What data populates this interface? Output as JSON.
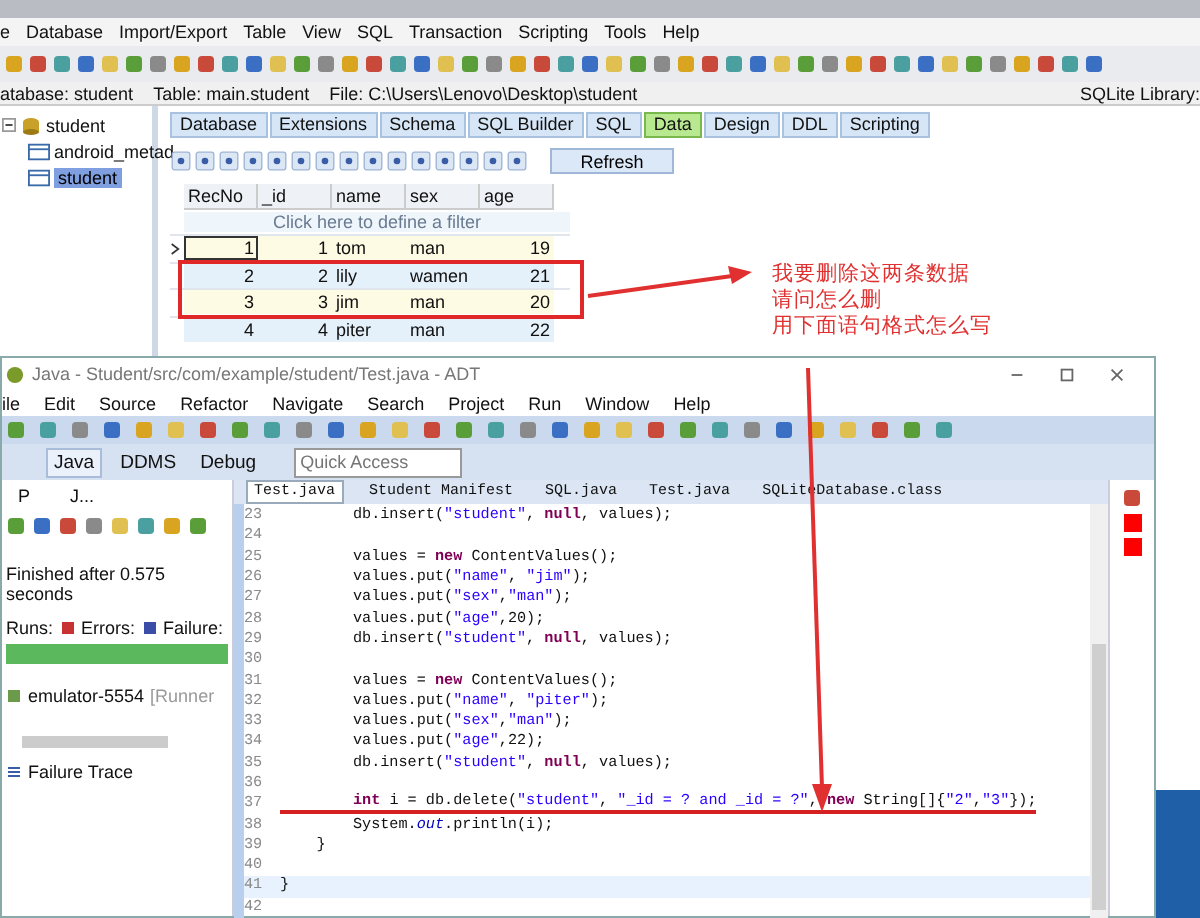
{
  "sqlite": {
    "menu": [
      "e",
      "Database",
      "Import/Export",
      "Table",
      "View",
      "SQL",
      "Transaction",
      "Scripting",
      "Tools",
      "Help"
    ],
    "info": {
      "database": "atabase: student",
      "table": "Table: main.student",
      "file": "File: C:\\Users\\Lenovo\\Desktop\\student",
      "library": "SQLite Library:"
    },
    "tree": [
      {
        "label": "student",
        "expanded": true,
        "children": [
          {
            "label": "android_metad",
            "selected": false
          },
          {
            "label": "student",
            "selected": true
          }
        ]
      }
    ],
    "tabs": [
      {
        "label": "Database",
        "selected": false
      },
      {
        "label": "Extensions",
        "selected": false
      },
      {
        "label": "Schema",
        "selected": false
      },
      {
        "label": "SQL Builder",
        "selected": false
      },
      {
        "label": "SQL",
        "selected": false
      },
      {
        "label": "Data",
        "selected": true
      },
      {
        "label": "Design",
        "selected": false
      },
      {
        "label": "DDL",
        "selected": false
      },
      {
        "label": "Scripting",
        "selected": false
      }
    ],
    "refresh": "Refresh",
    "grid": {
      "columns": [
        "RecNo",
        "_id",
        "name",
        "sex",
        "age"
      ],
      "filter": "Click here to define a filter",
      "rows": [
        {
          "cells": [
            "1",
            "1",
            "tom",
            "man",
            "19"
          ],
          "current": true
        },
        {
          "cells": [
            "2",
            "2",
            "lily",
            "wamen",
            "21"
          ],
          "current": false
        },
        {
          "cells": [
            "3",
            "3",
            "jim",
            "man",
            "20"
          ],
          "current": false
        },
        {
          "cells": [
            "4",
            "4",
            "piter",
            "man",
            "22"
          ],
          "current": false
        }
      ]
    }
  },
  "annotation": {
    "lines": [
      "我要删除这两条数据",
      "请问怎么删",
      "用下面语句格式怎么写"
    ]
  },
  "eclipse": {
    "title": "Java - Student/src/com/example/student/Test.java - ADT",
    "menu": [
      "ile",
      "Edit",
      "Source",
      "Refactor",
      "Navigate",
      "Search",
      "Project",
      "Run",
      "Window",
      "Help"
    ],
    "perspectives": [
      {
        "label": "Java",
        "selected": true
      },
      {
        "label": "DDMS",
        "selected": false
      },
      {
        "label": "Debug",
        "selected": false
      }
    ],
    "quick_access": {
      "placeholder": "Quick Access"
    },
    "panel_tabs": [
      "P",
      "J..."
    ],
    "junit": {
      "status": "Finished after 0.575 seconds",
      "runs": "Runs:",
      "errors": "Errors:",
      "failures": "Failure:",
      "level": 1,
      "runner": "emulator-5554",
      "runner_note": "[Runner",
      "trace": "Failure Trace"
    },
    "editor_tabs": [
      {
        "label": "Test.java",
        "selected": true
      },
      {
        "label": "Student Manifest",
        "selected": false
      },
      {
        "label": "SQL.java",
        "selected": false
      },
      {
        "label": "Test.java",
        "selected": false
      },
      {
        "label": "SQLiteDatabase.class",
        "selected": false
      }
    ],
    "code": [
      {
        "num": "23",
        "parts": [
          {
            "kind": "plain",
            "text": "        db.insert("
          },
          {
            "kind": "string",
            "text": "\"student\""
          },
          {
            "kind": "plain",
            "text": ", "
          },
          {
            "kind": "keyword",
            "text": "null"
          },
          {
            "kind": "plain",
            "text": ", values);"
          }
        ]
      },
      {
        "num": "24"
      },
      {
        "num": "25",
        "parts": [
          {
            "kind": "plain",
            "text": "        values = "
          },
          {
            "kind": "keyword",
            "text": "new"
          },
          {
            "kind": "plain",
            "text": " ContentValues();"
          }
        ]
      },
      {
        "num": "26",
        "parts": [
          {
            "kind": "plain",
            "text": "        values.put("
          },
          {
            "kind": "string",
            "text": "\"name\""
          },
          {
            "kind": "plain",
            "text": ", "
          },
          {
            "kind": "string",
            "text": "\"jim\""
          },
          {
            "kind": "plain",
            "text": ");"
          }
        ]
      },
      {
        "num": "27",
        "parts": [
          {
            "kind": "plain",
            "text": "        values.put("
          },
          {
            "kind": "string",
            "text": "\"sex\""
          },
          {
            "kind": "plain",
            "text": ","
          },
          {
            "kind": "string",
            "text": "\"man\""
          },
          {
            "kind": "plain",
            "text": ");"
          }
        ]
      },
      {
        "num": "28",
        "parts": [
          {
            "kind": "plain",
            "text": "        values.put("
          },
          {
            "kind": "string",
            "text": "\"age\""
          },
          {
            "kind": "plain",
            "text": ",20);"
          }
        ]
      },
      {
        "num": "29",
        "parts": [
          {
            "kind": "plain",
            "text": "        db.insert("
          },
          {
            "kind": "string",
            "text": "\"student\""
          },
          {
            "kind": "plain",
            "text": ", "
          },
          {
            "kind": "keyword",
            "text": "null"
          },
          {
            "kind": "plain",
            "text": ", values);"
          }
        ]
      },
      {
        "num": "30"
      },
      {
        "num": "31",
        "parts": [
          {
            "kind": "plain",
            "text": "        values = "
          },
          {
            "kind": "keyword",
            "text": "new"
          },
          {
            "kind": "plain",
            "text": " ContentValues();"
          }
        ]
      },
      {
        "num": "32",
        "parts": [
          {
            "kind": "plain",
            "text": "        values.put("
          },
          {
            "kind": "string",
            "text": "\"name\""
          },
          {
            "kind": "plain",
            "text": ", "
          },
          {
            "kind": "string",
            "text": "\"piter\""
          },
          {
            "kind": "plain",
            "text": ");"
          }
        ]
      },
      {
        "num": "33",
        "parts": [
          {
            "kind": "plain",
            "text": "        values.put("
          },
          {
            "kind": "string",
            "text": "\"sex\""
          },
          {
            "kind": "plain",
            "text": ","
          },
          {
            "kind": "string",
            "text": "\"man\""
          },
          {
            "kind": "plain",
            "text": ");"
          }
        ]
      },
      {
        "num": "34",
        "parts": [
          {
            "kind": "plain",
            "text": "        values.put("
          },
          {
            "kind": "string",
            "text": "\"age\""
          },
          {
            "kind": "plain",
            "text": ",22);"
          }
        ]
      },
      {
        "num": "35",
        "parts": [
          {
            "kind": "plain",
            "text": "        db.insert("
          },
          {
            "kind": "string",
            "text": "\"student\""
          },
          {
            "kind": "plain",
            "text": ", "
          },
          {
            "kind": "keyword",
            "text": "null"
          },
          {
            "kind": "plain",
            "text": ", values);"
          }
        ]
      },
      {
        "num": "36"
      },
      {
        "num": "37",
        "underlined": true,
        "parts": [
          {
            "kind": "keyword",
            "text": "        int"
          },
          {
            "kind": "plain",
            "text": " i = db.delete("
          },
          {
            "kind": "string",
            "text": "\"student\""
          },
          {
            "kind": "plain",
            "text": ", "
          },
          {
            "kind": "string",
            "text": "\"_id = ? and _id = ?\""
          },
          {
            "kind": "plain",
            "text": ", "
          },
          {
            "kind": "keyword",
            "text": "new"
          },
          {
            "kind": "plain",
            "text": " String[]{"
          },
          {
            "kind": "string",
            "text": "\"2\""
          },
          {
            "kind": "plain",
            "text": ","
          },
          {
            "kind": "string",
            "text": "\"3\""
          },
          {
            "kind": "plain",
            "text": "});"
          }
        ]
      },
      {
        "num": "38",
        "parts": [
          {
            "kind": "plain",
            "text": "        System."
          },
          {
            "kind": "field",
            "text": "out"
          },
          {
            "kind": "plain",
            "text": ".println(i);"
          }
        ]
      },
      {
        "num": "39",
        "parts": [
          {
            "kind": "plain",
            "text": "    }"
          }
        ]
      },
      {
        "num": "40"
      },
      {
        "num": "41",
        "current": true,
        "parts": [
          {
            "kind": "plain",
            "text": "}"
          }
        ]
      },
      {
        "num": "42"
      }
    ]
  }
}
